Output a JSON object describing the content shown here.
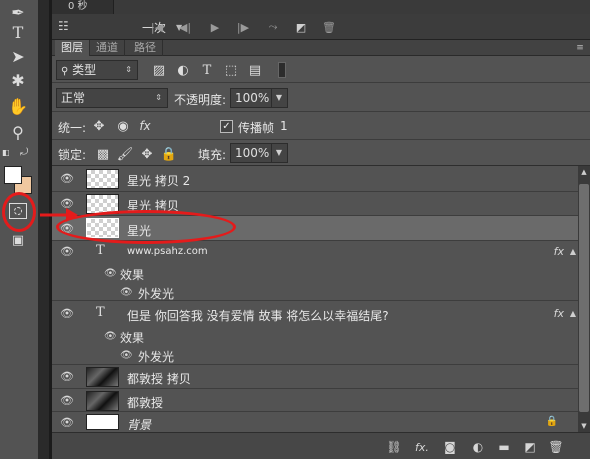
{
  "timeline": {
    "frame_time": "0 秒",
    "loop_select": "一次",
    "buttons": [
      "first-frame-icon",
      "prev-frame-icon",
      "play-icon",
      "next-frame-icon",
      "tween-icon",
      "duplicate-frame-icon",
      "delete-frame-icon"
    ]
  },
  "tabs": [
    {
      "label": "图层",
      "active": true
    },
    {
      "label": "通道",
      "active": false
    },
    {
      "label": "路径",
      "active": false
    }
  ],
  "filter": {
    "kind_label": "类型"
  },
  "blend": {
    "mode": "正常",
    "opacity_label": "不透明度:",
    "opacity_value": "100%"
  },
  "unify": {
    "label": "统一:",
    "propagate_label": "传播帧",
    "propagate_value": "1"
  },
  "lock": {
    "label": "锁定:",
    "fill_label": "填充:",
    "fill_value": "100%"
  },
  "layers": [
    {
      "name": "星光 拷贝 2",
      "thumb": "checker",
      "visible": true
    },
    {
      "name": "星光 拷贝",
      "thumb": "checker",
      "visible": true
    },
    {
      "name": "星光",
      "thumb": "checker",
      "visible": true,
      "selected": true
    },
    {
      "name": "www.psahz.com",
      "type": "text",
      "fx": "fx",
      "effects_label": "效果",
      "effect_name": "外发光"
    },
    {
      "name": "但是 你回答我 没有爱情 故事 将怎么以幸福结尾?",
      "type": "text",
      "fx": "fx",
      "effects_label": "效果",
      "effect_name": "外发光"
    },
    {
      "name": "都敦授 拷贝",
      "thumb": "photo",
      "visible": true
    },
    {
      "name": "都敦授",
      "thumb": "photo",
      "visible": true
    },
    {
      "name": "背景",
      "thumb": "white",
      "visible": true,
      "locked": true
    }
  ],
  "accent_colors": {
    "annotation": "#e41b1b",
    "selected_row": "#6a6a6a"
  }
}
